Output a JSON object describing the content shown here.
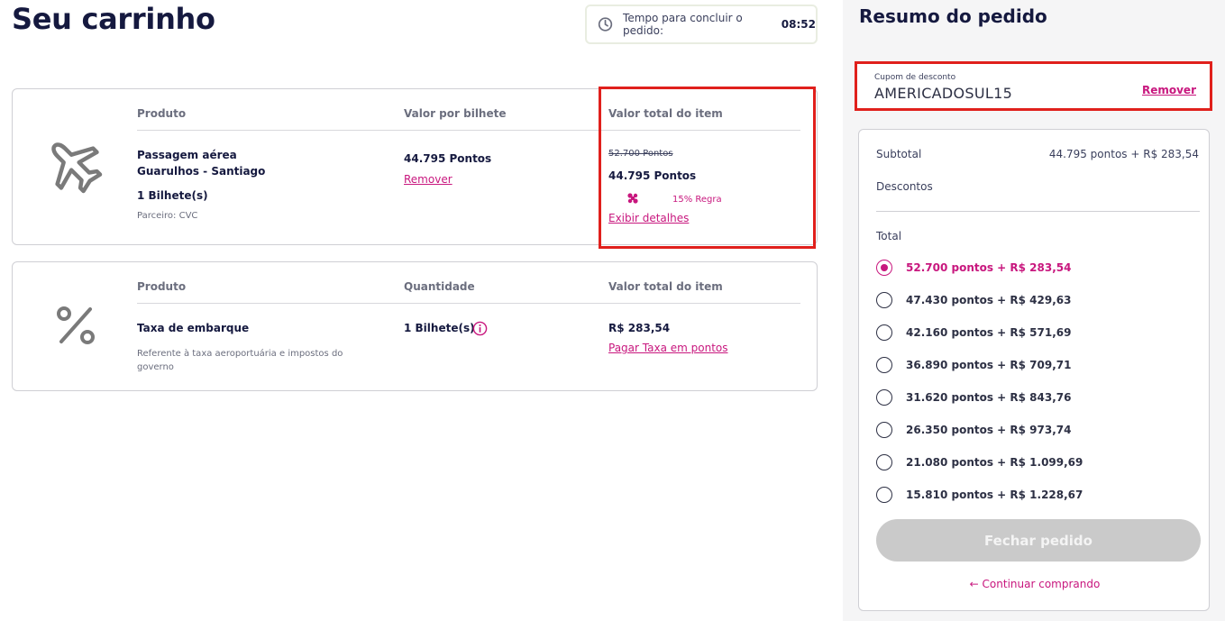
{
  "page": {
    "title": "Seu carrinho"
  },
  "timer": {
    "label": "Tempo para concluir o pedido:",
    "value": "08:52"
  },
  "cart": {
    "item1": {
      "icon": "airplane-icon",
      "col_product": "Produto",
      "col_unit": "Valor por bilhete",
      "col_total": "Valor total do item",
      "name_line1": "Passagem aérea",
      "name_line2": "Guarulhos - Santiago",
      "quantity": "1 Bilhete(s)",
      "partner": "Parceiro: CVC",
      "unit_value": "44.795 Pontos",
      "remove_label": "Remover",
      "old_total": "52.700 Pontos",
      "total": "44.795 Pontos",
      "discount_rule": "15% Regra",
      "details_link": "Exibir detalhes"
    },
    "item2": {
      "icon": "percent-icon",
      "col_product": "Produto",
      "col_qty": "Quantidade",
      "col_total": "Valor total do item",
      "name": "Taxa de embarque",
      "description_line1": "Referente à taxa aeroportuária e impostos do",
      "description_line2": "governo",
      "quantity": "1 Bilhete(s)",
      "total": "R$ 283,54",
      "pay_points_link": "Pagar Taxa em pontos"
    }
  },
  "summary": {
    "title": "Resumo do pedido",
    "coupon": {
      "label": "Cupom de desconto",
      "code": "AMERICADOSUL15",
      "remove_label": "Remover"
    },
    "subtotal_label": "Subtotal",
    "subtotal_value": "44.795 pontos + R$ 283,54",
    "discounts_label": "Descontos",
    "total_label": "Total",
    "options": [
      {
        "label": "52.700 pontos + R$ 283,54",
        "selected": true
      },
      {
        "label": "47.430 pontos + R$ 429,63",
        "selected": false
      },
      {
        "label": "42.160 pontos + R$ 571,69",
        "selected": false
      },
      {
        "label": "36.890 pontos + R$ 709,71",
        "selected": false
      },
      {
        "label": "31.620 pontos + R$ 843,76",
        "selected": false
      },
      {
        "label": "26.350 pontos + R$ 973,74",
        "selected": false
      },
      {
        "label": "21.080 pontos + R$ 1.099,69",
        "selected": false
      },
      {
        "label": "15.810 pontos + R$ 1.228,67",
        "selected": false
      }
    ],
    "checkout_label": "Fechar pedido",
    "continue_label": "Continuar comprando"
  },
  "colors": {
    "accent": "#c8177e",
    "title": "#15193f",
    "highlight_box": "#e0201c",
    "disabled_button": "#cacaca"
  }
}
